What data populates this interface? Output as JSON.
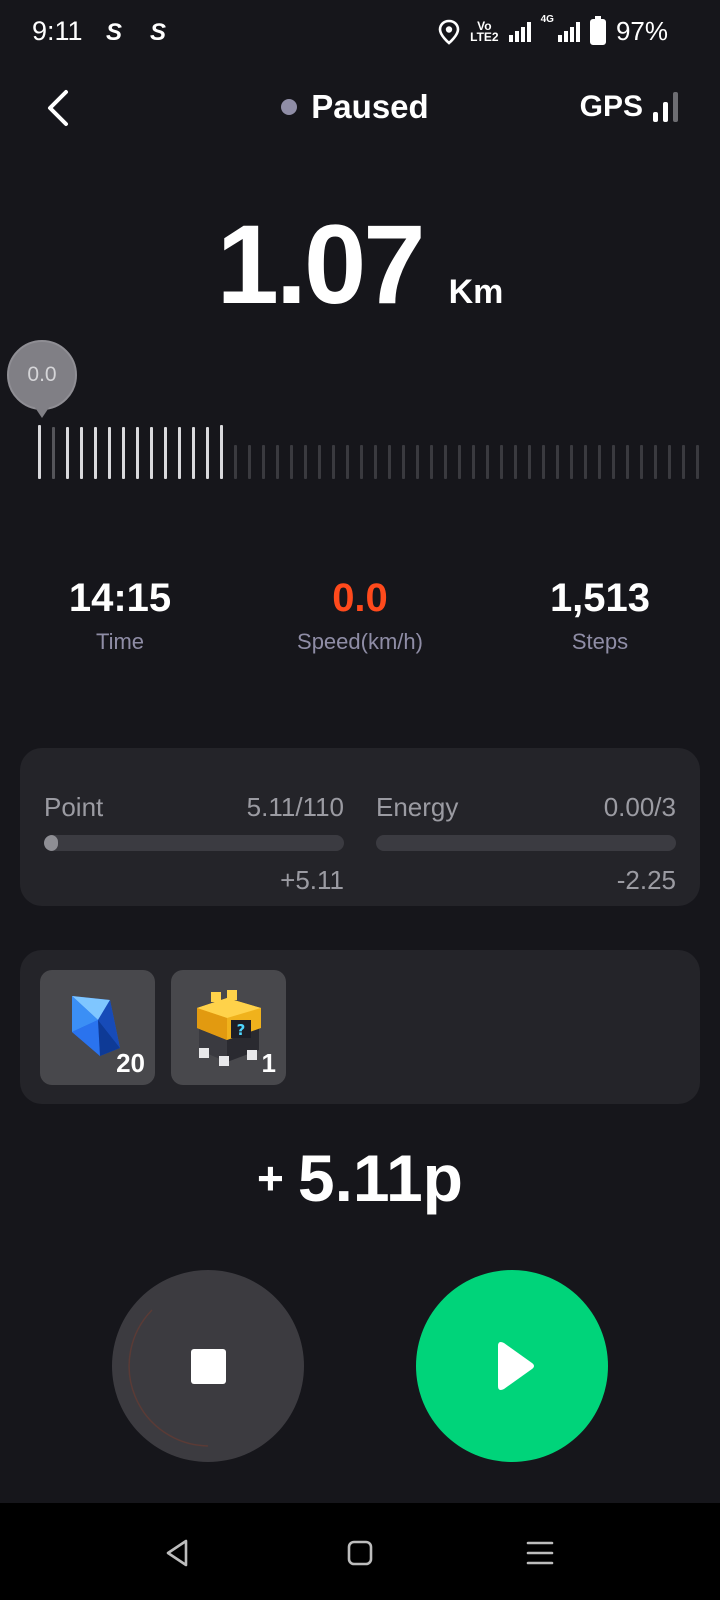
{
  "status_bar": {
    "time": "9:11",
    "app_icon_1": "S",
    "app_icon_2": "S",
    "volte_label_top": "Vo",
    "volte_label_bottom": "LTE2",
    "network_label": "4G",
    "battery": "97%"
  },
  "header": {
    "status": "Paused",
    "gps_label": "GPS",
    "gps_strength_bars": 2,
    "gps_total_bars": 3
  },
  "distance": {
    "value": "1.07",
    "unit": "Km"
  },
  "gauge": {
    "current_speed": "0.0",
    "active_ticks": 14,
    "total_ticks": 48
  },
  "stats": {
    "time": {
      "value": "14:15",
      "label": "Time"
    },
    "speed": {
      "value": "0.0",
      "label": "Speed(km/h)"
    },
    "steps": {
      "value": "1,513",
      "label": "Steps"
    }
  },
  "progress": {
    "point": {
      "label": "Point",
      "value": "5.11/110",
      "fraction": 0.046,
      "delta": "+5.11"
    },
    "energy": {
      "label": "Energy",
      "value": "0.00/3",
      "fraction": 0.0,
      "delta": "-2.25"
    }
  },
  "items": [
    {
      "icon": "blue-gem-icon",
      "count": "20"
    },
    {
      "icon": "mystery-box-icon",
      "count": "1"
    }
  ],
  "earned": {
    "plus": "+",
    "value": "5.11p"
  },
  "colors": {
    "background": "#16161b",
    "accent_green": "#00d47a",
    "speed_red": "#ff4a1c",
    "muted_label": "#8f8da6"
  }
}
